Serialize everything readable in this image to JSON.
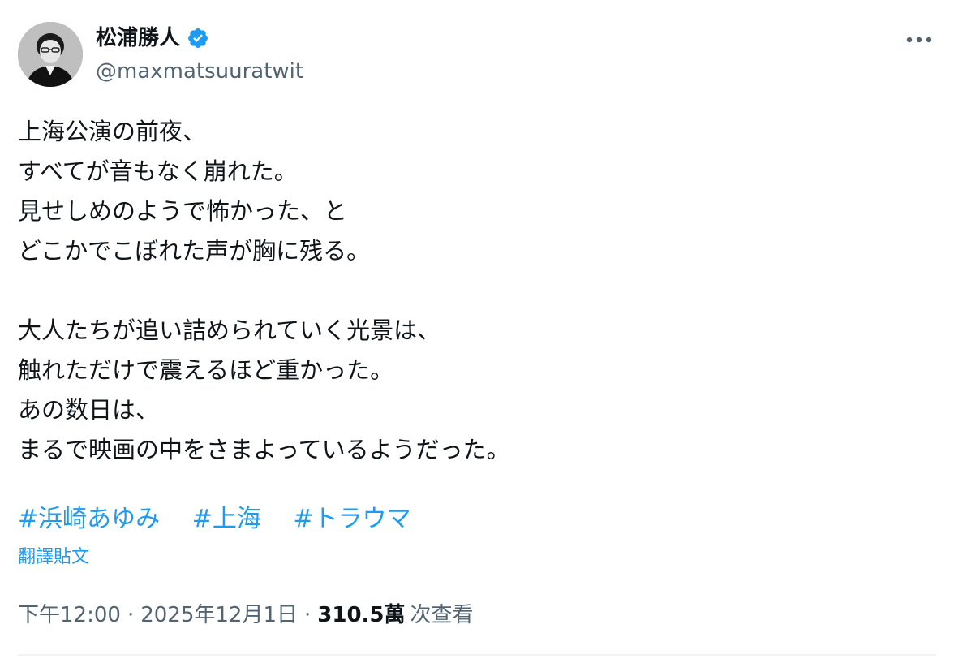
{
  "author": {
    "display_name": "松浦勝人",
    "handle": "@maxmatsuuratwit",
    "verified": true,
    "verified_color": "#1d9bf0",
    "avatar_icon": "profile-photo"
  },
  "more_icon": "more-horizontal-icon",
  "tweet": {
    "lines": [
      "上海公演の前夜、",
      "すべてが音もなく崩れた。",
      "見せしめのようで怖かった、と",
      "どこかでこぼれた声が胸に残る。",
      "",
      "大人たちが追い詰められていく光景は、",
      "触れただけで震えるほど重かった。",
      "あの数日は、",
      "まるで映画の中をさまよっているようだった。"
    ],
    "hashtags": [
      "#浜崎あゆみ",
      "#上海",
      "#トラウマ"
    ],
    "translate_label": "翻譯貼文"
  },
  "meta": {
    "time": "下午12:00",
    "separator": "·",
    "date": "2025年12月1日",
    "views_count": "310.5萬",
    "views_label": "次查看"
  },
  "colors": {
    "text": "#0f1419",
    "secondary": "#536471",
    "link": "#1d9bf0"
  }
}
